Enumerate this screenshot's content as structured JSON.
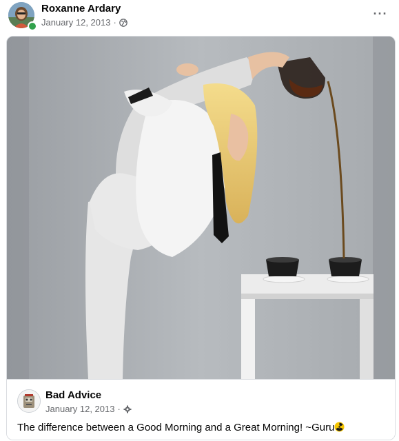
{
  "post": {
    "author": "Roxanne Ardary",
    "date": "January 12, 2013",
    "separator": "·",
    "privacy_icon": "globe-icon",
    "more_icon": "more-options-icon",
    "more_label": "···"
  },
  "shared": {
    "page_name": "Bad Advice",
    "date": "January 12, 2013",
    "separator": "·",
    "audience_icon": "gear-icon",
    "caption": "The difference between a Good Morning and a Great Morning! ~Guru",
    "caption_emoji": "radioactive-icon"
  },
  "colors": {
    "online": "#31a24c",
    "secondary_text": "#65676b",
    "photo_background": "#a5a9ae",
    "radioactive": "#f7c600"
  }
}
